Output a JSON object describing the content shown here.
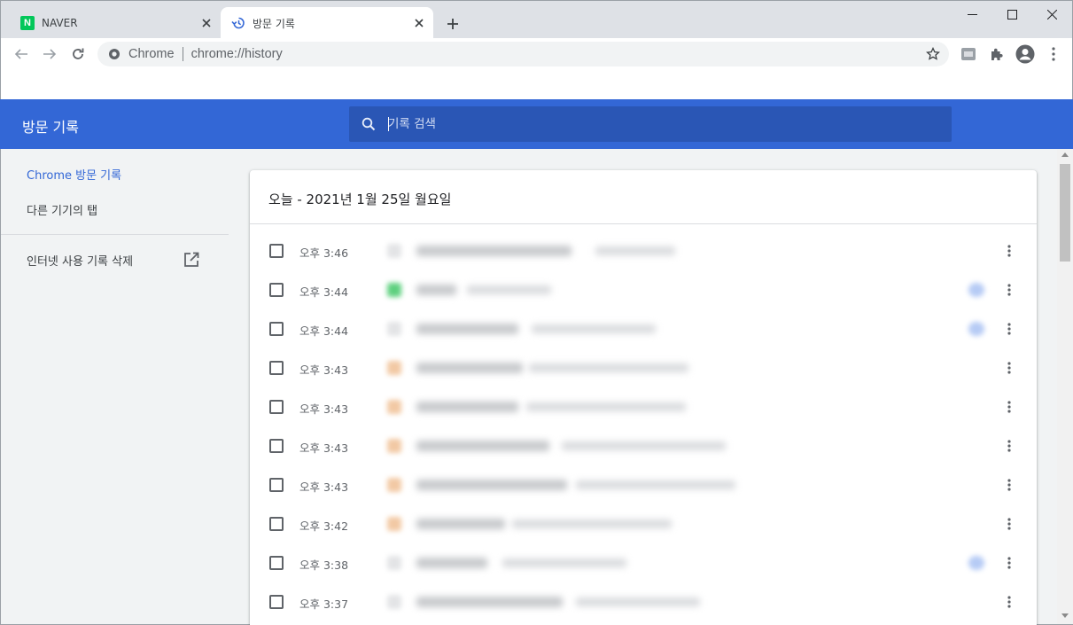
{
  "tabs": [
    {
      "title": "NAVER",
      "favicon": "naver-logo",
      "active": false
    },
    {
      "title": "방문 기록",
      "favicon": "history-icon",
      "active": true
    }
  ],
  "naver_logo_letter": "N",
  "toolbar": {
    "omnibox_site_label": "Chrome",
    "omnibox_url": "chrome://history"
  },
  "header": {
    "title": "방문 기록",
    "search_placeholder": "기록 검색"
  },
  "sidebar": {
    "items": [
      {
        "label": "Chrome 방문 기록",
        "selected": true
      },
      {
        "label": "다른 기기의 탭",
        "selected": false
      },
      {
        "label": "인터넷 사용 기록 삭제",
        "selected": false
      }
    ]
  },
  "history": {
    "date_heading": "오늘 - 2021년 1월 25일 월요일",
    "rows": [
      {
        "time": "오후 3:46"
      },
      {
        "time": "오후 3:44"
      },
      {
        "time": "오후 3:44"
      },
      {
        "time": "오후 3:43"
      },
      {
        "time": "오후 3:43"
      },
      {
        "time": "오후 3:43"
      },
      {
        "time": "오후 3:43"
      },
      {
        "time": "오후 3:42"
      },
      {
        "time": "오후 3:38"
      },
      {
        "time": "오후 3:37"
      }
    ]
  },
  "colors": {
    "header_blue": "#3367d6",
    "search_blue": "#2a56b5",
    "selected_text": "#3367d6",
    "naver_green": "#03c75a"
  }
}
